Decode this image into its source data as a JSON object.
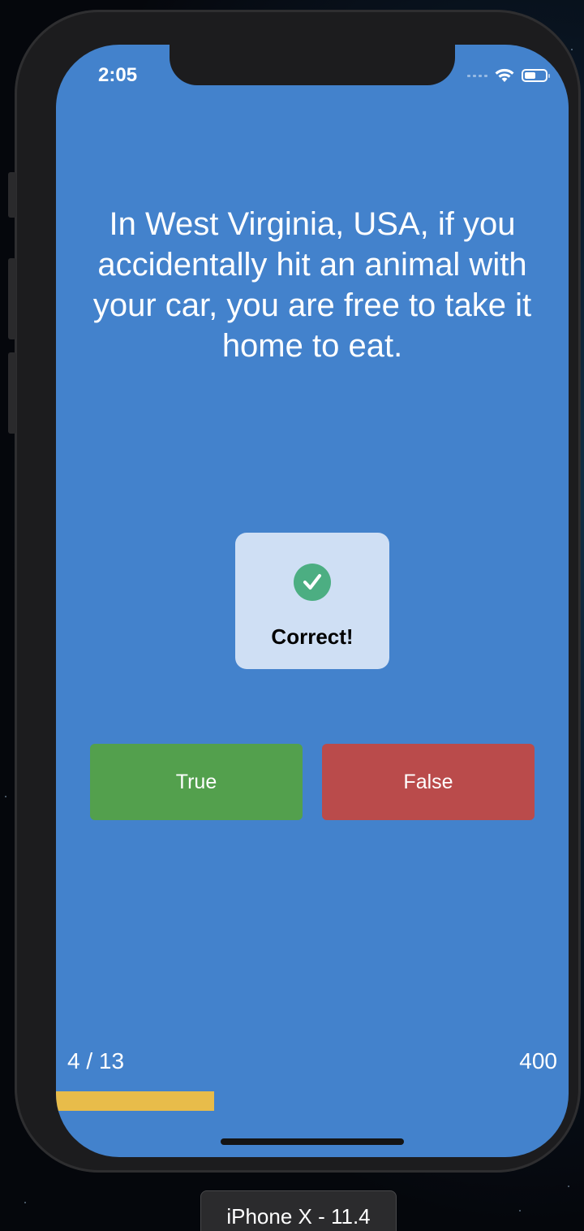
{
  "status_bar": {
    "time": "2:05"
  },
  "quiz": {
    "question": "In West Virginia, USA, if you accidentally hit an animal with your car, you are free to take it home to eat.",
    "feedback": {
      "icon": "checkmark-circle-icon",
      "text": "Correct!",
      "color": "#4cae82"
    },
    "answers": {
      "true_label": "True",
      "false_label": "False"
    },
    "progress": {
      "label": "4 / 13",
      "fraction": 0.308
    },
    "score": "400"
  },
  "simulator": {
    "device_label": "iPhone X - 11.4"
  },
  "colors": {
    "background": "#4382cc",
    "true_button": "#53a04d",
    "false_button": "#ba4b4b",
    "progress_fill": "#e8bc4a"
  }
}
